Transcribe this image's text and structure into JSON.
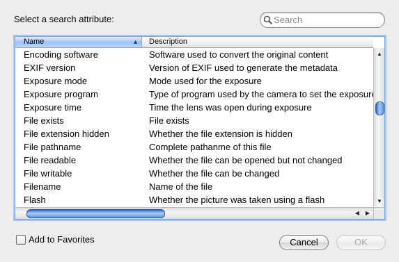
{
  "dialog": {
    "prompt": "Select a search attribute:",
    "search": {
      "placeholder": "Search",
      "value": ""
    },
    "columns": {
      "name": "Name",
      "description": "Description",
      "sort": "ascending"
    },
    "rows": [
      {
        "name": "Encoding software",
        "description": "Software used to convert the original content"
      },
      {
        "name": "EXIF version",
        "description": "Version of EXIF used to generate the metadata"
      },
      {
        "name": "Exposure mode",
        "description": "Mode used for the exposure"
      },
      {
        "name": "Exposure program",
        "description": "Type of program used by the camera to set the exposure"
      },
      {
        "name": "Exposure time",
        "description": "Time the lens was open during exposure"
      },
      {
        "name": "File exists",
        "description": "File exists"
      },
      {
        "name": "File extension hidden",
        "description": "Whether the file extension is hidden"
      },
      {
        "name": "File pathname",
        "description": "Complete pathanme of this file"
      },
      {
        "name": "File readable",
        "description": "Whether the file can be opened but not changed"
      },
      {
        "name": "File writable",
        "description": "Whether the file can be changed"
      },
      {
        "name": "Filename",
        "description": "Name of the file"
      },
      {
        "name": "Flash",
        "description": "Whether the picture was taken using a flash"
      }
    ],
    "favorites": {
      "label": "Add to Favorites",
      "checked": false
    },
    "buttons": {
      "cancel": "Cancel",
      "ok": "OK",
      "ok_enabled": false
    }
  },
  "icons": {
    "search": "magnifier-icon",
    "sort": "sort-up-icon"
  },
  "colors": {
    "accent": "#3d78d6",
    "header_selected": "#9dc2f2",
    "disabled_text": "#a9a9a9"
  }
}
